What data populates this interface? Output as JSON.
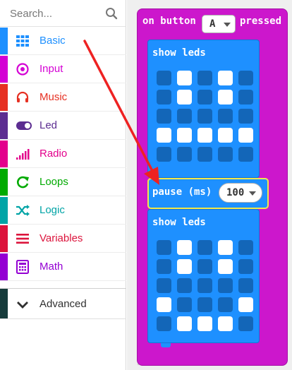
{
  "search": {
    "placeholder": "Search..."
  },
  "categories": [
    {
      "label": "Basic",
      "icon": "grid-icon",
      "color": "#1e90ff",
      "stripe": "#1e90ff"
    },
    {
      "label": "Input",
      "icon": "target-icon",
      "color": "#d400d4",
      "stripe": "#d400d4"
    },
    {
      "label": "Music",
      "icon": "headphones-icon",
      "color": "#e63022",
      "stripe": "#e63022"
    },
    {
      "label": "Led",
      "icon": "toggle-icon",
      "color": "#5c2d91",
      "stripe": "#5c2d91"
    },
    {
      "label": "Radio",
      "icon": "signal-bars-icon",
      "color": "#e3008c",
      "stripe": "#e3008c"
    },
    {
      "label": "Loops",
      "icon": "refresh-icon",
      "color": "#00aa00",
      "stripe": "#00aa00"
    },
    {
      "label": "Logic",
      "icon": "shuffle-icon",
      "color": "#00a4a6",
      "stripe": "#00a4a6"
    },
    {
      "label": "Variables",
      "icon": "list-lines-icon",
      "color": "#dc143c",
      "stripe": "#dc143c"
    },
    {
      "label": "Math",
      "icon": "calculator-icon",
      "color": "#9400d3",
      "stripe": "#9400d3"
    }
  ],
  "advanced": {
    "label": "Advanced",
    "icon": "chevron-down-icon"
  },
  "event_block": {
    "prefix": "on button",
    "button_value": "A",
    "suffix": "pressed"
  },
  "show_leds_1": {
    "label": "show leds"
  },
  "show_leds_2": {
    "label": "show leds"
  },
  "pause_block": {
    "label": "pause (ms)",
    "value": "100"
  },
  "leds_1": [
    [
      0,
      1,
      0,
      1,
      0
    ],
    [
      0,
      1,
      0,
      1,
      0
    ],
    [
      0,
      0,
      0,
      0,
      0
    ],
    [
      1,
      1,
      1,
      1,
      1
    ],
    [
      0,
      0,
      0,
      0,
      0
    ]
  ],
  "leds_2": [
    [
      0,
      1,
      0,
      1,
      0
    ],
    [
      0,
      1,
      0,
      1,
      0
    ],
    [
      0,
      0,
      0,
      0,
      0
    ],
    [
      1,
      0,
      0,
      0,
      1
    ],
    [
      0,
      1,
      1,
      1,
      0
    ]
  ]
}
